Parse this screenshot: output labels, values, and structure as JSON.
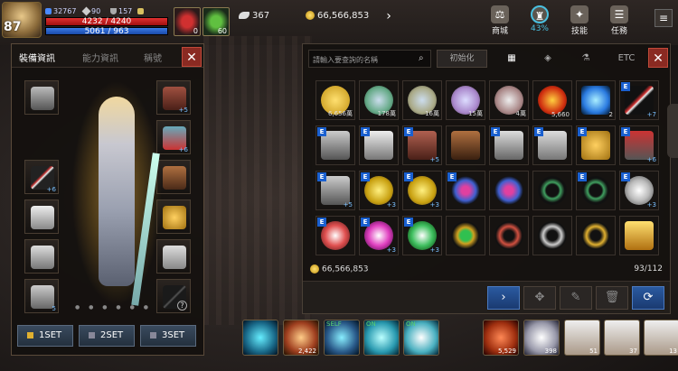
{
  "player": {
    "level": "87",
    "hp_text": "4232 / 4240",
    "hp_fraction": 0.998,
    "mp_text": "5061 / 963",
    "mp_fraction": 1.0,
    "stats": [
      {
        "icon": "gem-icon",
        "value": "32767"
      },
      {
        "icon": "sword-icon",
        "value": "90"
      },
      {
        "icon": "shield-icon",
        "value": "157"
      }
    ]
  },
  "quick_slots": [
    {
      "icon": "red-potion-icon",
      "count": "0"
    },
    {
      "icon": "leaf-icon",
      "count": "60"
    }
  ],
  "currency": {
    "feather": "367",
    "gold": "66,566,853"
  },
  "top_menu": [
    {
      "icon": "shop-icon",
      "label": "商城"
    },
    {
      "icon": "bag-icon",
      "label": "43%"
    },
    {
      "icon": "skill-icon",
      "label": "技能"
    },
    {
      "icon": "quest-icon",
      "label": "任務"
    }
  ],
  "colors": {
    "hp": "#e03030",
    "mp": "#3a7ae8",
    "accent": "#2a5aa0",
    "close": "#8a2a22"
  },
  "equip_panel": {
    "tabs": [
      "裝備資訊",
      "能力資訊",
      "稱號"
    ],
    "left_slots": [
      {
        "icon": "helmet-icon",
        "plus": ""
      },
      {
        "icon": "sword-icon",
        "plus": "+6"
      },
      {
        "icon": "armor-icon",
        "plus": ""
      },
      {
        "icon": "boots-icon",
        "plus": ""
      },
      {
        "icon": "greaves-icon",
        "plus": "5"
      }
    ],
    "right_slots": [
      {
        "icon": "cloak-icon",
        "plus": "+5"
      },
      {
        "icon": "gauntlet-icon",
        "plus": "+6"
      },
      {
        "icon": "robe-icon",
        "plus": ""
      },
      {
        "icon": "wings-icon",
        "plus": ""
      },
      {
        "icon": "glove-icon",
        "plus": ""
      },
      {
        "icon": "help-icon",
        "plus": ""
      }
    ],
    "sets": [
      "1SET",
      "2SET",
      "3SET"
    ]
  },
  "inventory": {
    "search_placeholder": "請輸入要查詢的名稱",
    "reset_label": "初始化",
    "tabs": [
      "grid-icon",
      "rune-icon",
      "potion-icon",
      "ETC"
    ],
    "gold": "66,566,853",
    "capacity": "93/112",
    "rows": [
      [
        {
          "icon": "gold-pile-icon",
          "count": "6,656萬",
          "e": false
        },
        {
          "icon": "green-coin-icon",
          "count": "178萬",
          "e": false
        },
        {
          "icon": "blue-coin-icon",
          "count": "16萬",
          "e": false
        },
        {
          "icon": "purple-coin-icon",
          "count": "15萬",
          "e": false
        },
        {
          "icon": "red-coin-icon",
          "count": "4萬",
          "e": false
        },
        {
          "icon": "fire-orb-icon",
          "count": "5,660",
          "e": false
        },
        {
          "icon": "blue-crystal-icon",
          "count": "2",
          "e": false
        },
        {
          "icon": "red-blade-icon",
          "count": "+7",
          "e": true
        }
      ],
      [
        {
          "icon": "helmet-icon",
          "count": "",
          "e": true
        },
        {
          "icon": "armor-icon",
          "count": "",
          "e": true
        },
        {
          "icon": "cloak-icon",
          "count": "+5",
          "e": true
        },
        {
          "icon": "robe-icon",
          "count": "",
          "e": false
        },
        {
          "icon": "boots-icon",
          "count": "",
          "e": true
        },
        {
          "icon": "gauntlet-icon",
          "count": "",
          "e": true
        },
        {
          "icon": "wings-icon",
          "count": "",
          "e": true
        },
        {
          "icon": "bracer-icon",
          "count": "+6",
          "e": true
        }
      ],
      [
        {
          "icon": "greaves-icon",
          "count": "+5",
          "e": true
        },
        {
          "icon": "gold-wings-icon",
          "count": "+3",
          "e": true
        },
        {
          "icon": "gold-wings-icon",
          "count": "+3",
          "e": true
        },
        {
          "icon": "gem-bracelet-icon",
          "count": "",
          "e": true
        },
        {
          "icon": "gem-bracelet-icon",
          "count": "",
          "e": false
        },
        {
          "icon": "necklace-icon",
          "count": "",
          "e": false
        },
        {
          "icon": "necklace-icon",
          "count": "",
          "e": true
        },
        {
          "icon": "white-crest-icon",
          "count": "+3",
          "e": true
        }
      ],
      [
        {
          "icon": "red-crest-icon",
          "count": "",
          "e": true
        },
        {
          "icon": "pink-shield-icon",
          "count": "+3",
          "e": true
        },
        {
          "icon": "green-shield-icon",
          "count": "+3",
          "e": true
        },
        {
          "icon": "emerald-ring-icon",
          "count": "",
          "e": false
        },
        {
          "icon": "ruby-ring-icon",
          "count": "",
          "e": false
        },
        {
          "icon": "silver-ring-icon",
          "count": "",
          "e": false
        },
        {
          "icon": "gold-ring-icon",
          "count": "",
          "e": false
        },
        {
          "icon": "gold-book-icon",
          "count": "",
          "e": false
        }
      ]
    ]
  },
  "skills": [
    {
      "icon": "sun-rune-icon",
      "count": ""
    },
    {
      "icon": "dragon-icon",
      "count": "2,422"
    },
    {
      "icon": "self-shield-icon",
      "count": "",
      "tag": "SELF"
    },
    {
      "icon": "whirl-icon",
      "count": "",
      "tag": "ON"
    },
    {
      "icon": "holy-cross-icon",
      "count": "",
      "tag": "ON"
    },
    {
      "icon": "potion-icon",
      "count": "5,529"
    },
    {
      "icon": "silver-scroll-icon",
      "count": "398"
    },
    {
      "icon": "quill-scroll-icon",
      "count": "51"
    },
    {
      "icon": "return-scroll-icon",
      "count": "37"
    },
    {
      "icon": "teleport-scroll-icon",
      "count": "13"
    }
  ]
}
